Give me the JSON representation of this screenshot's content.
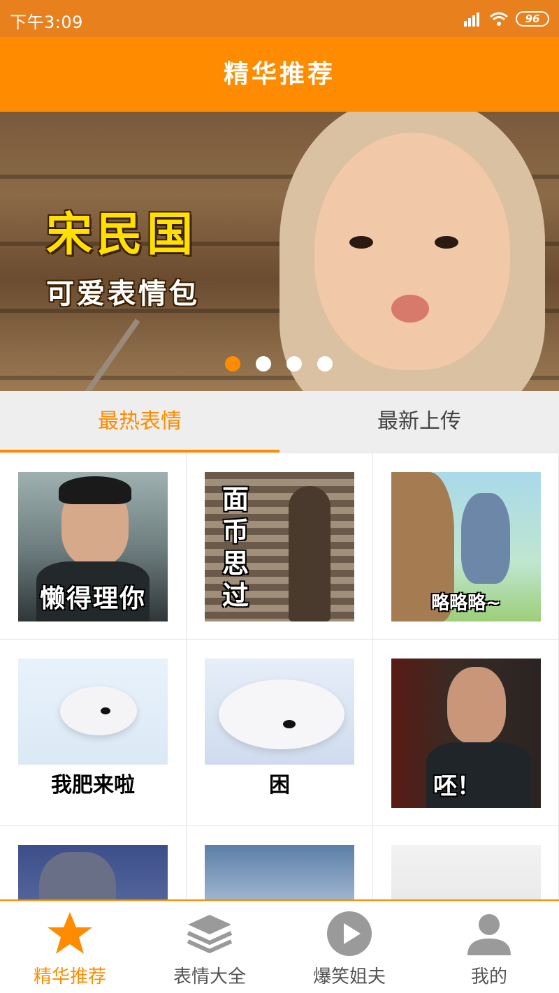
{
  "status": {
    "time": "下午3:09",
    "battery": "96"
  },
  "header": {
    "title": "精华推荐"
  },
  "banner": {
    "title": "宋民国",
    "subtitle": "可爱表情包",
    "slides": 4,
    "active_slide": 0
  },
  "tabs": [
    {
      "label": "最热表情",
      "active": true
    },
    {
      "label": "最新上传",
      "active": false
    }
  ],
  "grid": {
    "items": [
      {
        "caption": "懒得理你"
      },
      {
        "caption": "面币思过"
      },
      {
        "caption": "略略略~"
      },
      {
        "caption": "我肥来啦"
      },
      {
        "caption": "困"
      },
      {
        "caption": "呸！"
      }
    ]
  },
  "bottom_nav": [
    {
      "label": "精华推荐",
      "icon": "star-icon",
      "active": true
    },
    {
      "label": "表情大全",
      "icon": "layers-icon",
      "active": false
    },
    {
      "label": "爆笑姐夫",
      "icon": "play-icon",
      "active": false
    },
    {
      "label": "我的",
      "icon": "user-icon",
      "active": false
    }
  ],
  "colors": {
    "accent": "#FF8C00",
    "statusbar": "#E8801E"
  }
}
